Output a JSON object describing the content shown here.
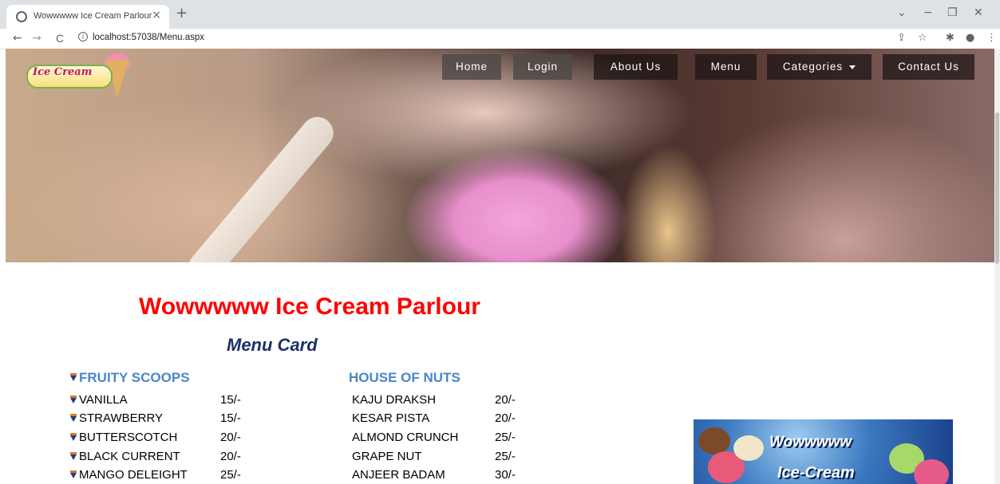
{
  "browser": {
    "tab_title": "Wowwwww Ice Cream Parlour",
    "tab_close": "×",
    "new_tab": "+",
    "url": "localhost:57038/Menu.aspx",
    "back": "←",
    "forward": "→",
    "reload": "C",
    "window_controls": {
      "dropdown": "⌄",
      "minimize": "−",
      "restore": "❐",
      "close": "✕"
    },
    "toolbar_icons": {
      "share": "⇪",
      "star": "☆",
      "extensions": "✱",
      "profile": "●",
      "menu": "⋮"
    }
  },
  "site": {
    "logo_text": "Ice Cream",
    "nav": [
      "Home",
      "Login",
      "About Us",
      "Menu",
      "Categories",
      "Contact Us"
    ]
  },
  "page": {
    "title": "Wowwwww Ice Cream Parlour",
    "subtitle": "Menu Card"
  },
  "menu": {
    "fruity": {
      "heading": "FRUITY SCOOPS",
      "items": [
        {
          "name": "VANILLA",
          "price": "15/-"
        },
        {
          "name": "STRAWBERRY",
          "price": "15/-"
        },
        {
          "name": "BUTTERSCOTCH",
          "price": "20/-"
        },
        {
          "name": "BLACK CURRENT",
          "price": "20/-"
        },
        {
          "name": "MANGO DELEIGHT",
          "price": "25/-"
        }
      ]
    },
    "nuts": {
      "heading": "HOUSE OF NUTS",
      "items": [
        {
          "name": "KAJU DRAKSH",
          "price": "20/-"
        },
        {
          "name": "KESAR PISTA",
          "price": "20/-"
        },
        {
          "name": "ALMOND CRUNCH",
          "price": "25/-"
        },
        {
          "name": "GRAPE NUT",
          "price": "25/-"
        },
        {
          "name": "ANJEER BADAM",
          "price": "30/-"
        }
      ]
    }
  },
  "promo": {
    "line1": "Wowwwww",
    "line2": "Ice-Cream"
  },
  "colors": {
    "title_red": "#ff0000",
    "subtitle_navy": "#1f2f6b",
    "heading_blue": "#4a86c8"
  }
}
